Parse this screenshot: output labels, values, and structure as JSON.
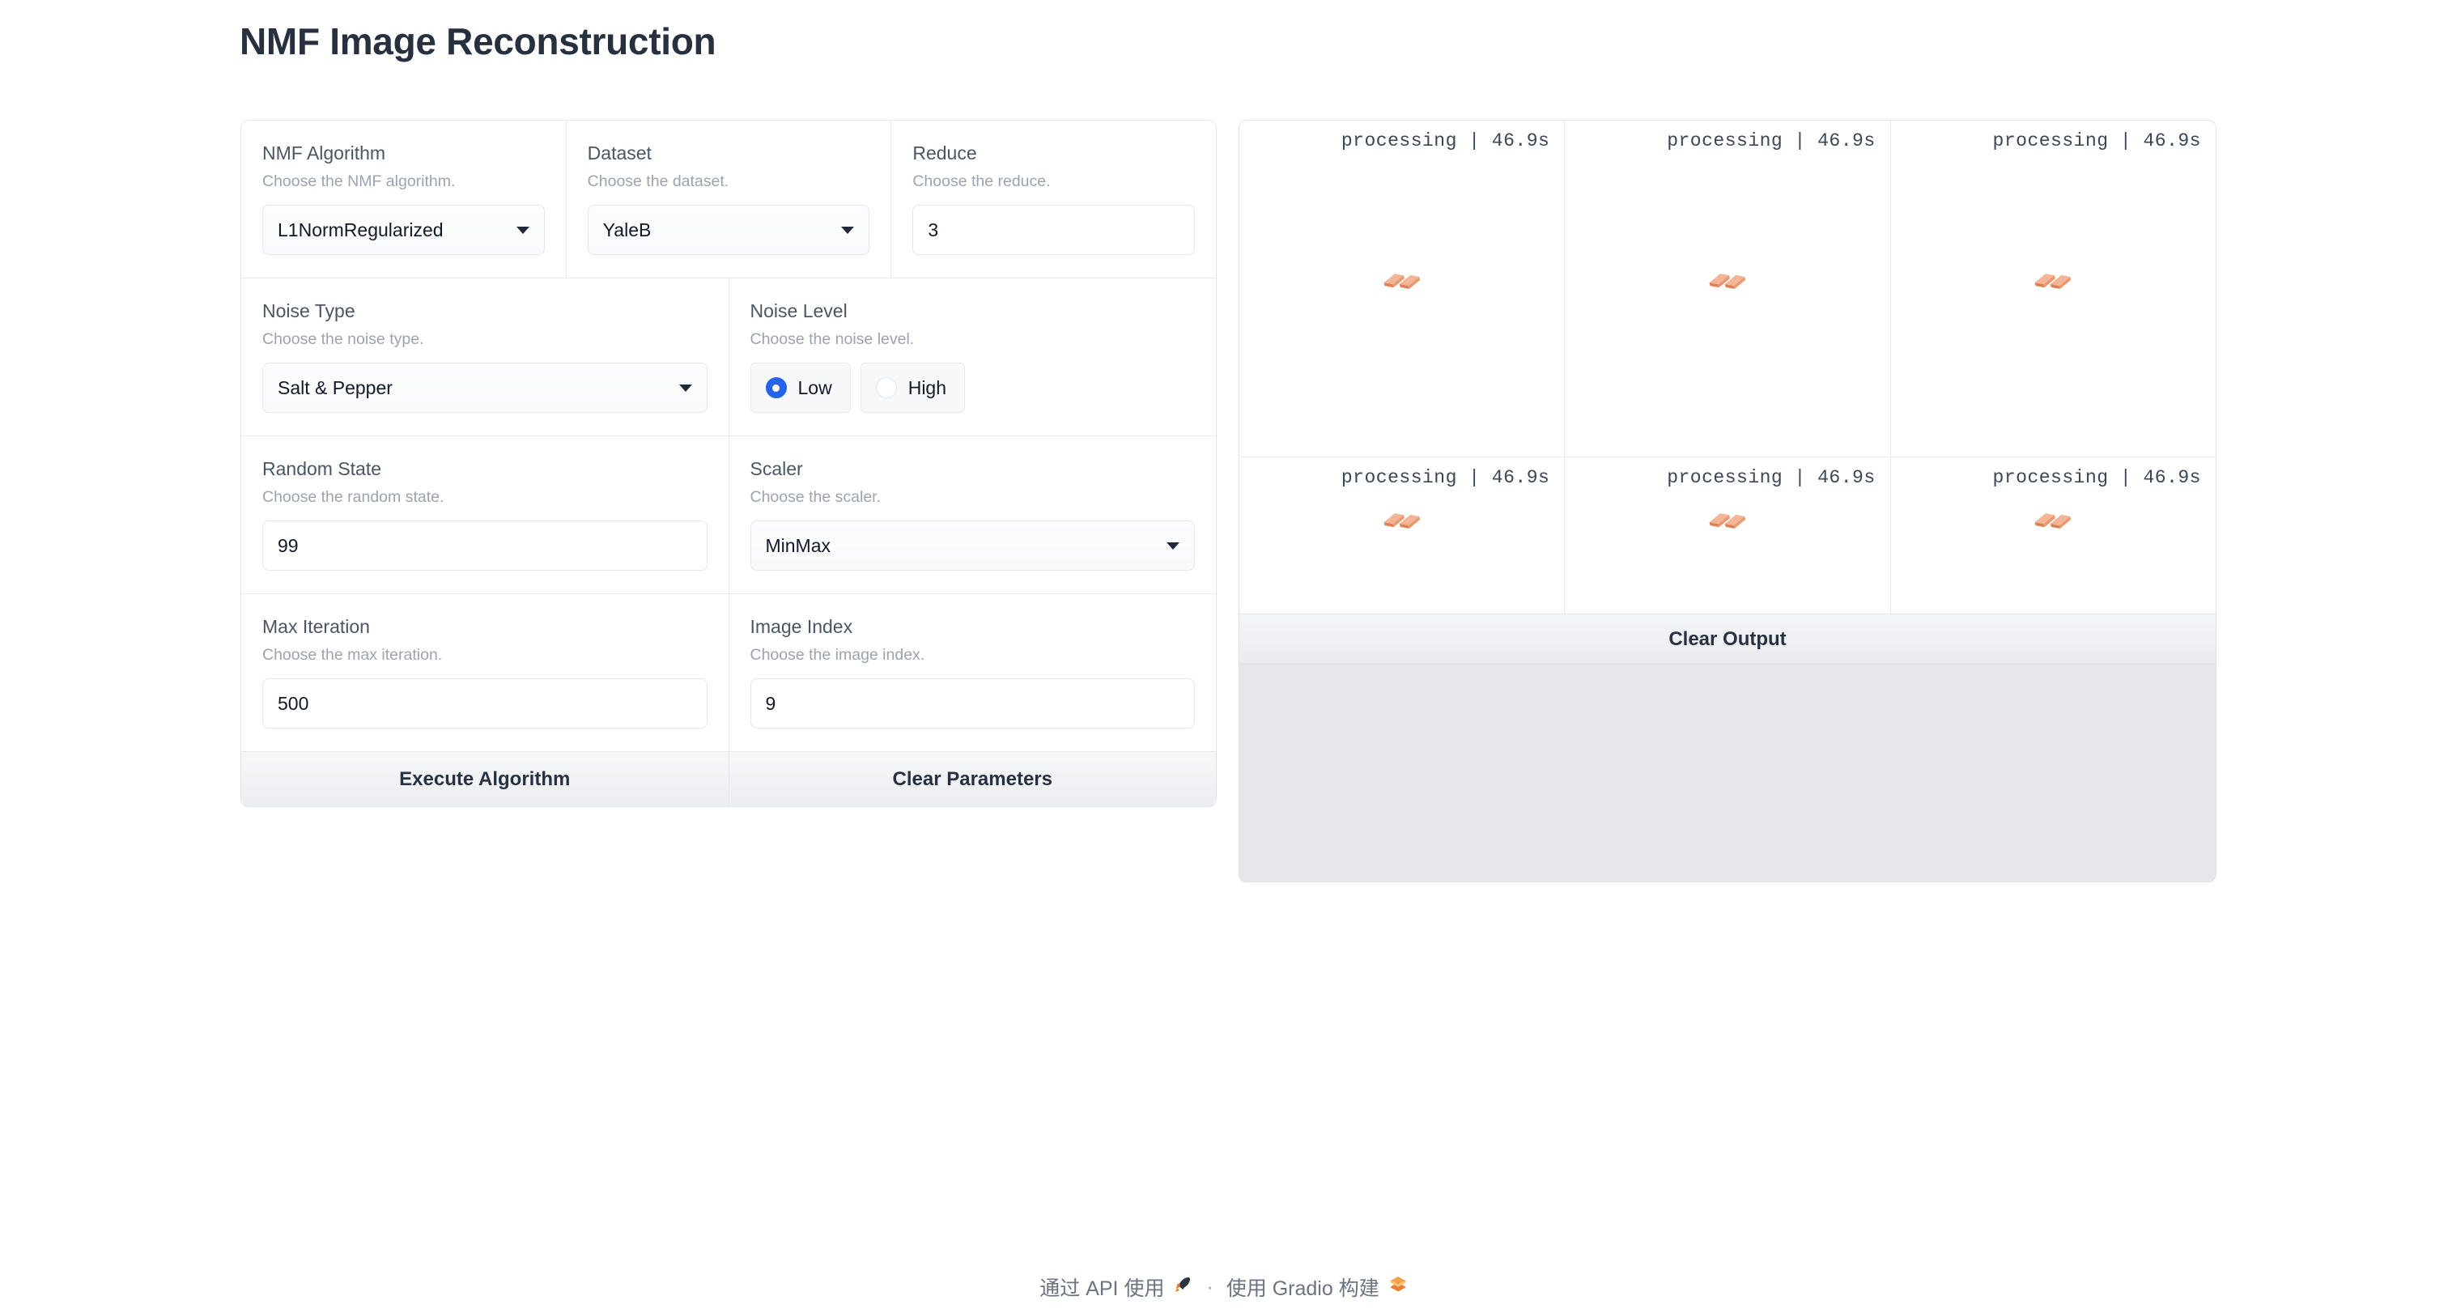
{
  "page": {
    "title": "NMF Image Reconstruction"
  },
  "parameters": {
    "rows": [
      [
        {
          "label": "NMF Algorithm",
          "info": "Choose the NMF algorithm.",
          "type": "dropdown",
          "value": "L1NormRegularized",
          "name": "nmf-algorithm"
        },
        {
          "label": "Dataset",
          "info": "Choose the dataset.",
          "type": "dropdown",
          "value": "YaleB",
          "name": "dataset"
        },
        {
          "label": "Reduce",
          "info": "Choose the reduce.",
          "type": "input",
          "value": "3",
          "name": "reduce"
        }
      ],
      [
        {
          "label": "Noise Type",
          "info": "Choose the noise type.",
          "type": "dropdown",
          "value": "Salt & Pepper",
          "name": "noise-type"
        },
        {
          "label": "Noise Level",
          "info": "Choose the noise level.",
          "type": "radio",
          "value": "Low",
          "options": [
            "Low",
            "High"
          ],
          "name": "noise-level"
        }
      ],
      [
        {
          "label": "Random State",
          "info": "Choose the random state.",
          "type": "input",
          "value": "99",
          "name": "random-state"
        },
        {
          "label": "Scaler",
          "info": "Choose the scaler.",
          "type": "dropdown",
          "value": "MinMax",
          "name": "scaler"
        }
      ],
      [
        {
          "label": "Max Iteration",
          "info": "Choose the max iteration.",
          "type": "input",
          "value": "500",
          "name": "max-iteration"
        },
        {
          "label": "Image Index",
          "info": "Choose the image index.",
          "type": "input",
          "value": "9",
          "name": "image-index"
        }
      ]
    ],
    "buttons": [
      {
        "label": "Execute Algorithm",
        "name": "execute-algorithm-button"
      },
      {
        "label": "Clear Parameters",
        "name": "clear-parameters-button"
      }
    ]
  },
  "output": {
    "gallery": {
      "rows": [
        [
          {
            "status": "processing  |  46.9s"
          },
          {
            "status": "processing  |  46.9s"
          },
          {
            "status": "processing  |  46.9s"
          }
        ],
        [
          {
            "status": "processing  |  46.9s"
          },
          {
            "status": "processing  |  46.9s"
          },
          {
            "status": "processing  |  46.9s"
          }
        ]
      ]
    },
    "clear_output_label": "Clear Output",
    "loader_color": "#e08košer"
  },
  "colors": {
    "accent_blue": "#2563eb",
    "loader_orange": "#e2825a",
    "loader_orange_light": "#f0a883",
    "panel_border": "#e5e7eb",
    "title_color": "#27303f",
    "output_bg": "#e5e7eb"
  },
  "footer": {
    "api_text": "通过 API 使用",
    "rocket_icon": "rocket-icon",
    "separator": "·",
    "built_text": "使用 Gradio 构建",
    "gradio_icon": "gradio-logo-icon"
  }
}
